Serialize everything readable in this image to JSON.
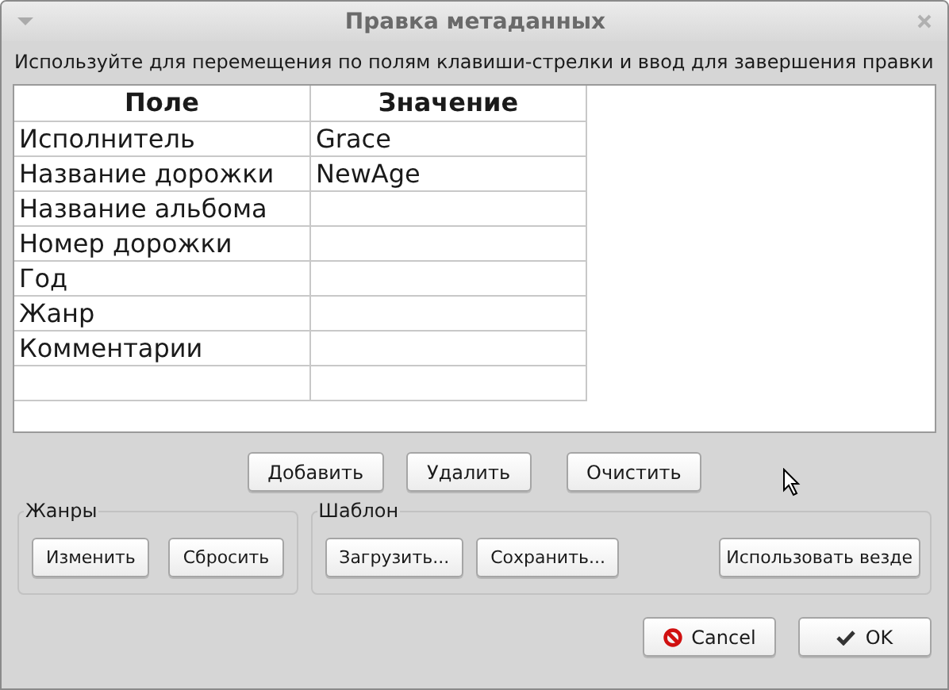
{
  "window": {
    "title": "Правка метаданных"
  },
  "instruction": "Используйте для перемещения по полям клавиши-стрелки и ввод для завершения правки",
  "table": {
    "columns": [
      "Поле",
      "Значение"
    ],
    "rows": [
      {
        "field": "Исполнитель",
        "value": "Grace"
      },
      {
        "field": "Название дорожки",
        "value": "NewAge"
      },
      {
        "field": "Название альбома",
        "value": ""
      },
      {
        "field": "Номер дорожки",
        "value": ""
      },
      {
        "field": "Год",
        "value": ""
      },
      {
        "field": "Жанр",
        "value": ""
      },
      {
        "field": "Комментарии",
        "value": ""
      },
      {
        "field": "",
        "value": ""
      }
    ]
  },
  "row_buttons": [
    "Добавить",
    "Удалить",
    "Очистить"
  ],
  "genres": {
    "title": "Жанры",
    "buttons": [
      "Изменить",
      "Сбросить"
    ]
  },
  "template": {
    "title": "Шаблон",
    "buttons": [
      "Загрузить...",
      "Сохранить..."
    ],
    "apply_button": "Использовать везде"
  },
  "dialog_buttons": [
    {
      "kind": "cancel",
      "label": "Cancel"
    },
    {
      "kind": "ok",
      "label": "OK"
    }
  ]
}
